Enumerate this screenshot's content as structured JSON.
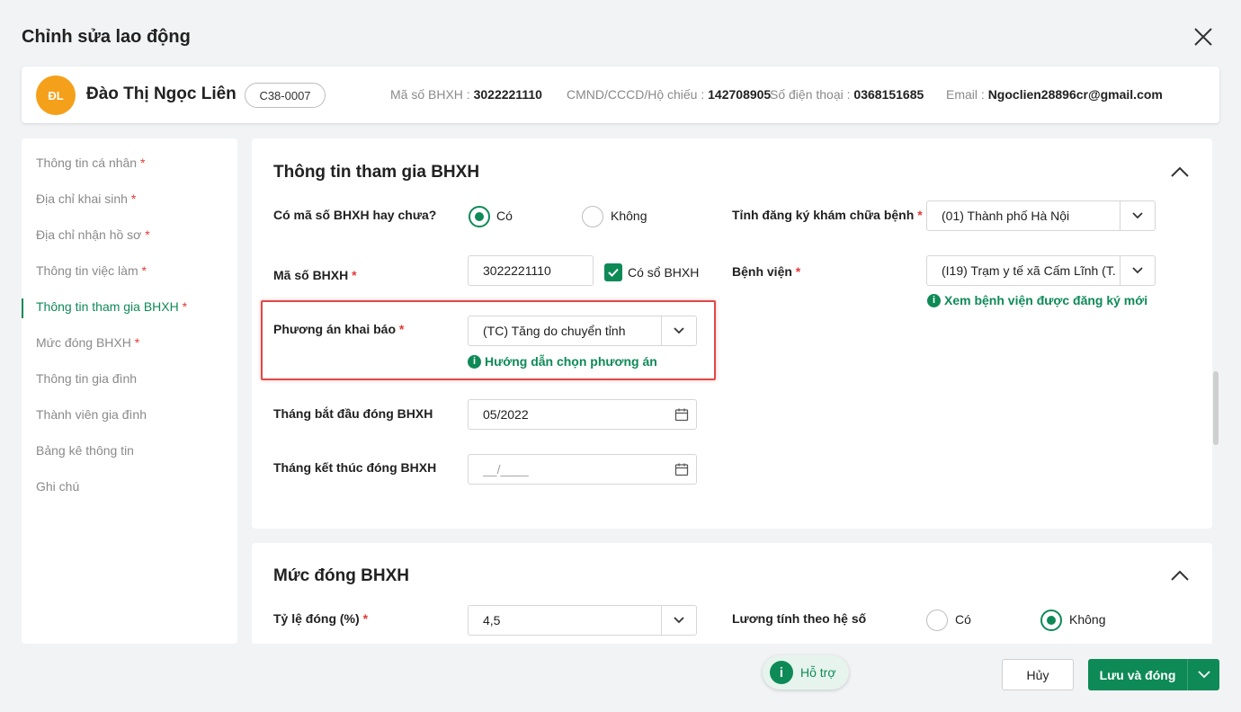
{
  "dialog": {
    "title": "Chỉnh sửa lao động"
  },
  "person": {
    "initials": "ĐL",
    "name": "Đào Thị Ngọc Liên",
    "code": "C38-0007",
    "social_insurance_label": "Mã số BHXH : ",
    "social_insurance_value": "3022221110",
    "id_label": "CMND/CCCD/Hộ chiếu : ",
    "id_value": "142708905",
    "phone_label": "Số điện thoại : ",
    "phone_value": "0368151685",
    "email_label": "Email : ",
    "email_value": "Ngoclien28896cr@gmail.com"
  },
  "sidebar": {
    "items": [
      {
        "label": "Thông tin cá nhân",
        "required": "*"
      },
      {
        "label": "Địa chỉ khai sinh",
        "required": "*"
      },
      {
        "label": "Địa chỉ nhận hồ sơ",
        "required": "*"
      },
      {
        "label": "Thông tin việc làm",
        "required": "*"
      },
      {
        "label": "Thông tin tham gia BHXH",
        "required": "*"
      },
      {
        "label": "Mức đóng BHXH",
        "required": "*"
      },
      {
        "label": "Thông tin gia đình"
      },
      {
        "label": "Thành viên gia đình"
      },
      {
        "label": "Bảng kê thông tin"
      },
      {
        "label": "Ghi chú"
      }
    ],
    "active_index": 4
  },
  "bhxh_section": {
    "title": "Thông tin tham gia BHXH",
    "has_code_label": "Có mã số BHXH hay chưa?",
    "has_code_yes": "Có",
    "has_code_no": "Không",
    "has_code_selected": "Có",
    "code_label": "Mã số BHXH",
    "code_value": "3022221110",
    "has_book_label": "Có sổ BHXH",
    "has_book_checked": true,
    "plan_label": "Phương án khai báo",
    "plan_value": "(TC) Tăng do chuyển tỉnh",
    "plan_hint": "Hướng dẫn chọn phương án",
    "start_label": "Tháng bắt đầu đóng BHXH",
    "start_value": "05/2022",
    "end_label": "Tháng kết thúc đóng BHXH",
    "end_placeholder": "__/____",
    "province_label": "Tỉnh đăng ký khám chữa bệnh",
    "province_value": "(01) Thành phố Hà Nội",
    "hospital_label": "Bệnh viện",
    "hospital_value": "(I19) Trạm y tế xã Cấm Lĩnh (T...",
    "hospital_hint": "Xem bệnh viện được đăng ký mới",
    "required_mark": "*"
  },
  "rate_section": {
    "title": "Mức đóng BHXH",
    "rate_label": "Tỷ lệ đóng (%)",
    "rate_value": "4,5",
    "coef_label": "Lương tính theo hệ số",
    "coef_yes": "Có",
    "coef_no": "Không",
    "coef_selected": "Không",
    "required_mark": "*"
  },
  "footer": {
    "support_label": "Hỗ trợ",
    "cancel_label": "Hủy",
    "save_label": "Lưu và đóng"
  },
  "colors": {
    "accent": "#0e8a57",
    "avatar": "#f5a01a",
    "required": "#e53935",
    "highlight": "#e04848"
  }
}
